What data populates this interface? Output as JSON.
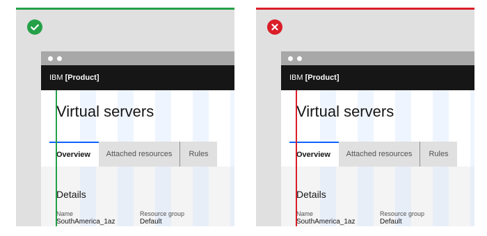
{
  "panels": [
    {
      "kind": "do",
      "accent": "#24a148",
      "badge_icon": "checkmark-icon",
      "app": {
        "brand": "IBM",
        "product": "[Product]",
        "title": "Virtual servers",
        "tabs": [
          "Overview",
          "Attached resources",
          "Rules"
        ],
        "active_tab": "Overview",
        "section_title": "Details",
        "fields": [
          {
            "label": "Name",
            "value": "SouthAmerica_1az"
          },
          {
            "label": "Resource group",
            "value": "Default"
          }
        ]
      }
    },
    {
      "kind": "dont",
      "accent": "#da1e28",
      "badge_icon": "close-icon",
      "app": {
        "brand": "IBM",
        "product": "[Product]",
        "title": "Virtual servers",
        "tabs": [
          "Overview",
          "Attached resources",
          "Rules"
        ],
        "active_tab": "Overview",
        "section_title": "Details",
        "fields": [
          {
            "label": "Name",
            "value": "SouthAmerica_1az"
          },
          {
            "label": "Resource group",
            "value": "Default"
          }
        ]
      }
    }
  ]
}
